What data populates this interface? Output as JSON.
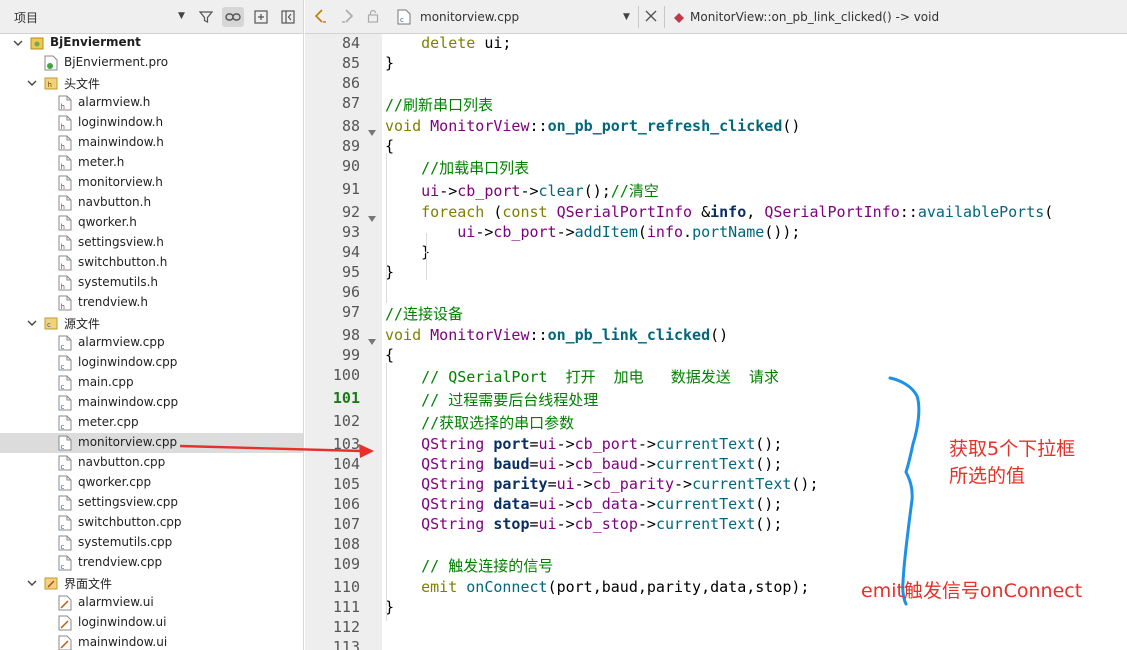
{
  "project_pane": {
    "selector_label": "项目",
    "tree": [
      {
        "label": "BjEnvierment",
        "kind": "project",
        "level": 0,
        "expanded": true,
        "bold": true
      },
      {
        "label": "BjEnvierment.pro",
        "kind": "pro",
        "level": 1
      },
      {
        "label": "头文件",
        "kind": "folder-h",
        "level": 1,
        "expanded": true
      },
      {
        "label": "alarmview.h",
        "kind": "h",
        "level": 2
      },
      {
        "label": "loginwindow.h",
        "kind": "h",
        "level": 2
      },
      {
        "label": "mainwindow.h",
        "kind": "h",
        "level": 2
      },
      {
        "label": "meter.h",
        "kind": "h",
        "level": 2
      },
      {
        "label": "monitorview.h",
        "kind": "h",
        "level": 2
      },
      {
        "label": "navbutton.h",
        "kind": "h",
        "level": 2
      },
      {
        "label": "qworker.h",
        "kind": "h",
        "level": 2
      },
      {
        "label": "settingsview.h",
        "kind": "h",
        "level": 2
      },
      {
        "label": "switchbutton.h",
        "kind": "h",
        "level": 2
      },
      {
        "label": "systemutils.h",
        "kind": "h",
        "level": 2
      },
      {
        "label": "trendview.h",
        "kind": "h",
        "level": 2
      },
      {
        "label": "源文件",
        "kind": "folder-cpp",
        "level": 1,
        "expanded": true
      },
      {
        "label": "alarmview.cpp",
        "kind": "cpp",
        "level": 2
      },
      {
        "label": "loginwindow.cpp",
        "kind": "cpp",
        "level": 2
      },
      {
        "label": "main.cpp",
        "kind": "cpp",
        "level": 2
      },
      {
        "label": "mainwindow.cpp",
        "kind": "cpp",
        "level": 2
      },
      {
        "label": "meter.cpp",
        "kind": "cpp",
        "level": 2
      },
      {
        "label": "monitorview.cpp",
        "kind": "cpp",
        "level": 2,
        "selected": true
      },
      {
        "label": "navbutton.cpp",
        "kind": "cpp",
        "level": 2
      },
      {
        "label": "qworker.cpp",
        "kind": "cpp",
        "level": 2
      },
      {
        "label": "settingsview.cpp",
        "kind": "cpp",
        "level": 2
      },
      {
        "label": "switchbutton.cpp",
        "kind": "cpp",
        "level": 2
      },
      {
        "label": "systemutils.cpp",
        "kind": "cpp",
        "level": 2
      },
      {
        "label": "trendview.cpp",
        "kind": "cpp",
        "level": 2
      },
      {
        "label": "界面文件",
        "kind": "folder-ui",
        "level": 1,
        "expanded": true
      },
      {
        "label": "alarmview.ui",
        "kind": "ui",
        "level": 2
      },
      {
        "label": "loginwindow.ui",
        "kind": "ui",
        "level": 2
      },
      {
        "label": "mainwindow.ui",
        "kind": "ui",
        "level": 2
      }
    ]
  },
  "editor": {
    "file_name": "monitorview.cpp",
    "function_name": "MonitorView::on_pb_link_clicked() -> void",
    "current_line": 101,
    "lines": [
      {
        "n": 84,
        "t": [
          [
            "    ",
            "pl"
          ],
          [
            "delete",
            "kw"
          ],
          [
            " ui;",
            "pl"
          ]
        ]
      },
      {
        "n": 85,
        "t": [
          [
            "}",
            "pl"
          ]
        ]
      },
      {
        "n": 86,
        "t": []
      },
      {
        "n": 87,
        "t": [
          [
            "//刷新串口列表",
            "cm"
          ]
        ]
      },
      {
        "n": 88,
        "fold": true,
        "t": [
          [
            "void",
            "kw"
          ],
          [
            " ",
            "pl"
          ],
          [
            "MonitorView",
            "ty"
          ],
          [
            "::",
            "pl"
          ],
          [
            "on_pb_port_refresh_clicked",
            "fnb"
          ],
          [
            "()",
            "pl"
          ]
        ]
      },
      {
        "n": 89,
        "t": [
          [
            "{",
            "pl"
          ]
        ]
      },
      {
        "n": 90,
        "t": [
          [
            "    ",
            "pl"
          ],
          [
            "//加载串口列表",
            "cm"
          ]
        ]
      },
      {
        "n": 91,
        "t": [
          [
            "    ",
            "pl"
          ],
          [
            "ui",
            "ty"
          ],
          [
            "->",
            "pl"
          ],
          [
            "cb_port",
            "ty"
          ],
          [
            "->",
            "pl"
          ],
          [
            "clear",
            "fn"
          ],
          [
            "();",
            "pl"
          ],
          [
            "//清空",
            "cm"
          ]
        ]
      },
      {
        "n": 92,
        "fold": true,
        "t": [
          [
            "    ",
            "pl"
          ],
          [
            "foreach",
            "kw"
          ],
          [
            " (",
            "pl"
          ],
          [
            "const",
            "kw"
          ],
          [
            " ",
            "pl"
          ],
          [
            "QSerialPortInfo",
            "ty"
          ],
          [
            " &",
            "pl"
          ],
          [
            "info",
            "vb"
          ],
          [
            ", ",
            "pl"
          ],
          [
            "QSerialPortInfo",
            "ty"
          ],
          [
            "::",
            "pl"
          ],
          [
            "availablePorts",
            "fn"
          ],
          [
            "(",
            "pl"
          ]
        ]
      },
      {
        "n": 93,
        "t": [
          [
            "        ",
            "pl"
          ],
          [
            "ui",
            "ty"
          ],
          [
            "->",
            "pl"
          ],
          [
            "cb_port",
            "ty"
          ],
          [
            "->",
            "pl"
          ],
          [
            "addItem",
            "fn"
          ],
          [
            "(",
            "pl"
          ],
          [
            "info",
            "ty"
          ],
          [
            ".",
            "pl"
          ],
          [
            "portName",
            "fn"
          ],
          [
            "());",
            "pl"
          ]
        ]
      },
      {
        "n": 94,
        "t": [
          [
            "    }",
            "pl"
          ]
        ]
      },
      {
        "n": 95,
        "t": [
          [
            "}",
            "pl"
          ]
        ]
      },
      {
        "n": 96,
        "t": []
      },
      {
        "n": 97,
        "t": [
          [
            "//连接设备",
            "cm"
          ]
        ]
      },
      {
        "n": 98,
        "fold": true,
        "t": [
          [
            "void",
            "kw"
          ],
          [
            " ",
            "pl"
          ],
          [
            "MonitorView",
            "ty"
          ],
          [
            "::",
            "pl"
          ],
          [
            "on_pb_link_clicked",
            "fnb"
          ],
          [
            "()",
            "pl"
          ]
        ]
      },
      {
        "n": 99,
        "t": [
          [
            "{",
            "pl"
          ]
        ]
      },
      {
        "n": 100,
        "t": [
          [
            "    ",
            "pl"
          ],
          [
            "// QSerialPort  打开  加电   数据发送  请求",
            "cm"
          ]
        ]
      },
      {
        "n": 101,
        "t": [
          [
            "    ",
            "pl"
          ],
          [
            "// 过程需要后台线程处理",
            "cm"
          ]
        ]
      },
      {
        "n": 102,
        "t": [
          [
            "    ",
            "pl"
          ],
          [
            "//获取选择的串口参数",
            "cm"
          ]
        ]
      },
      {
        "n": 103,
        "t": [
          [
            "    ",
            "pl"
          ],
          [
            "QString",
            "ty"
          ],
          [
            " ",
            "pl"
          ],
          [
            "port",
            "vb"
          ],
          [
            "=",
            "pl"
          ],
          [
            "ui",
            "ty"
          ],
          [
            "->",
            "pl"
          ],
          [
            "cb_port",
            "ty"
          ],
          [
            "->",
            "pl"
          ],
          [
            "currentText",
            "fn"
          ],
          [
            "();",
            "pl"
          ]
        ]
      },
      {
        "n": 104,
        "t": [
          [
            "    ",
            "pl"
          ],
          [
            "QString",
            "ty"
          ],
          [
            " ",
            "pl"
          ],
          [
            "baud",
            "vb"
          ],
          [
            "=",
            "pl"
          ],
          [
            "ui",
            "ty"
          ],
          [
            "->",
            "pl"
          ],
          [
            "cb_baud",
            "ty"
          ],
          [
            "->",
            "pl"
          ],
          [
            "currentText",
            "fn"
          ],
          [
            "();",
            "pl"
          ]
        ]
      },
      {
        "n": 105,
        "t": [
          [
            "    ",
            "pl"
          ],
          [
            "QString",
            "ty"
          ],
          [
            " ",
            "pl"
          ],
          [
            "parity",
            "vb"
          ],
          [
            "=",
            "pl"
          ],
          [
            "ui",
            "ty"
          ],
          [
            "->",
            "pl"
          ],
          [
            "cb_parity",
            "ty"
          ],
          [
            "->",
            "pl"
          ],
          [
            "currentText",
            "fn"
          ],
          [
            "();",
            "pl"
          ]
        ]
      },
      {
        "n": 106,
        "t": [
          [
            "    ",
            "pl"
          ],
          [
            "QString",
            "ty"
          ],
          [
            " ",
            "pl"
          ],
          [
            "data",
            "vb"
          ],
          [
            "=",
            "pl"
          ],
          [
            "ui",
            "ty"
          ],
          [
            "->",
            "pl"
          ],
          [
            "cb_data",
            "ty"
          ],
          [
            "->",
            "pl"
          ],
          [
            "currentText",
            "fn"
          ],
          [
            "();",
            "pl"
          ]
        ]
      },
      {
        "n": 107,
        "t": [
          [
            "    ",
            "pl"
          ],
          [
            "QString",
            "ty"
          ],
          [
            " ",
            "pl"
          ],
          [
            "stop",
            "vb"
          ],
          [
            "=",
            "pl"
          ],
          [
            "ui",
            "ty"
          ],
          [
            "->",
            "pl"
          ],
          [
            "cb_stop",
            "ty"
          ],
          [
            "->",
            "pl"
          ],
          [
            "currentText",
            "fn"
          ],
          [
            "();",
            "pl"
          ]
        ]
      },
      {
        "n": 108,
        "t": []
      },
      {
        "n": 109,
        "t": [
          [
            "    ",
            "pl"
          ],
          [
            "// 触发连接的信号",
            "cm"
          ]
        ]
      },
      {
        "n": 110,
        "t": [
          [
            "    ",
            "pl"
          ],
          [
            "emit",
            "kw"
          ],
          [
            " ",
            "pl"
          ],
          [
            "onConnect",
            "fn"
          ],
          [
            "(port,baud,parity,data,stop);",
            "pl"
          ]
        ]
      },
      {
        "n": 111,
        "t": [
          [
            "}",
            "pl"
          ]
        ]
      },
      {
        "n": 112,
        "t": []
      },
      {
        "n": 113,
        "t": []
      }
    ]
  },
  "annotations": {
    "brace_note_line1": "获取5个下拉框",
    "brace_note_line2": "所选的值",
    "emit_note": "emit触发信号onConnect",
    "ink_red": "#e8302a",
    "ink_blue": "#1e90e6"
  }
}
